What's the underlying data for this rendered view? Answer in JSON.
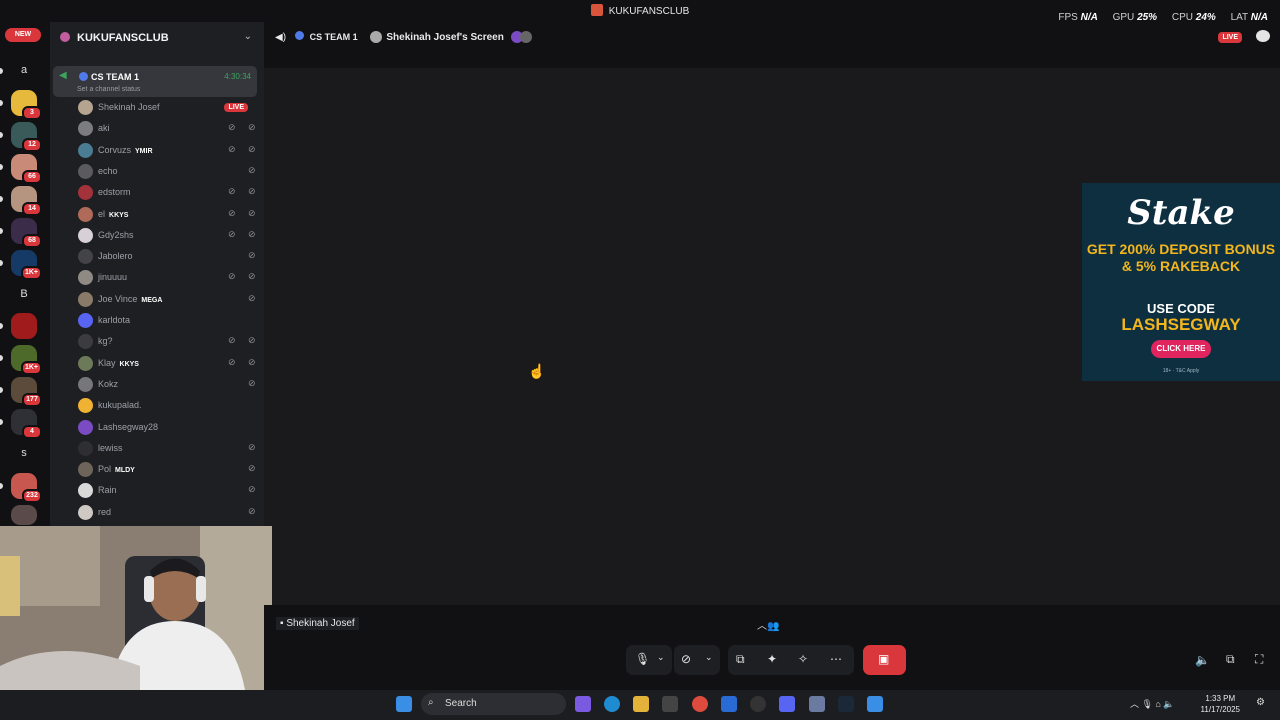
{
  "window": {
    "title": "KUKUFANSCLUB"
  },
  "perf": {
    "fps_label": "FPS",
    "fps_value": "N/A",
    "gpu_label": "GPU",
    "gpu_value": "25%",
    "cpu_label": "CPU",
    "cpu_value": "24%",
    "lat_label": "LAT",
    "lat_value": "N/A"
  },
  "rail": {
    "new_label": "NEW",
    "letters": [
      "a",
      "B",
      "s"
    ],
    "badges": [
      "3",
      "12",
      "66",
      "14",
      "68",
      "1K+",
      "1K+",
      "177",
      "4",
      "232"
    ]
  },
  "sidebar": {
    "server_name": "KUKUFANSCLUB",
    "channel": {
      "name": "CS TEAM 1",
      "time": "4:30:34",
      "status": "Set a channel status"
    },
    "live_label": "LIVE",
    "users": [
      {
        "name": "Shekinah Josef",
        "tag": "",
        "color": "#b5a48f"
      },
      {
        "name": "aki",
        "tag": "",
        "color": "#7c7c80"
      },
      {
        "name": "Corvuzs",
        "tag": "YMIR",
        "color": "#4a7c93"
      },
      {
        "name": "echo",
        "tag": "",
        "color": "#5a5a5f"
      },
      {
        "name": "edstorm",
        "tag": "",
        "color": "#a3323a"
      },
      {
        "name": "el",
        "tag": "KKYS",
        "color": "#b06a5a"
      },
      {
        "name": "Gdy2shs",
        "tag": "",
        "color": "#d7d0d6"
      },
      {
        "name": "Jabolero",
        "tag": "",
        "color": "#444448"
      },
      {
        "name": "jinuuuu",
        "tag": "",
        "color": "#8f8a84"
      },
      {
        "name": "Joe Vince",
        "tag": "MEGA",
        "color": "#8a7a68"
      },
      {
        "name": "karldota",
        "tag": "",
        "color": "#5865f2"
      },
      {
        "name": "kg?",
        "tag": "",
        "color": "#3b3b40"
      },
      {
        "name": "Klay",
        "tag": "KKYS",
        "color": "#6d7a5a"
      },
      {
        "name": "Kokz",
        "tag": "",
        "color": "#77777b"
      },
      {
        "name": "kukupalad.",
        "tag": "",
        "color": "#f0b232"
      },
      {
        "name": "Lashsegway28",
        "tag": "",
        "color": "#7a4bc2"
      },
      {
        "name": "lewiss",
        "tag": "",
        "color": "#2f2f33"
      },
      {
        "name": "Pol",
        "tag": "MLDY",
        "color": "#6e645a"
      },
      {
        "name": "Rain",
        "tag": "",
        "color": "#d9d9d9"
      },
      {
        "name": "red",
        "tag": "",
        "color": "#cfc9c4"
      }
    ]
  },
  "topbar": {
    "channel": "CS TEAM 1",
    "screen_title": "Shekinah Josef's Screen",
    "live_label": "LIVE"
  },
  "ad": {
    "brand": "Stake",
    "line1": "GET 200% DEPOSIT BONUS & 5% RAKEBACK",
    "line2": "USE CODE",
    "code": "LASHSEGWAY",
    "cta": "CLICK HERE",
    "fine": "18+ · T&C Apply"
  },
  "stream_label": "Shekinah Josef",
  "taskbar": {
    "search_placeholder": "Search",
    "time": "1:33 PM",
    "date": "11/17/2025"
  }
}
